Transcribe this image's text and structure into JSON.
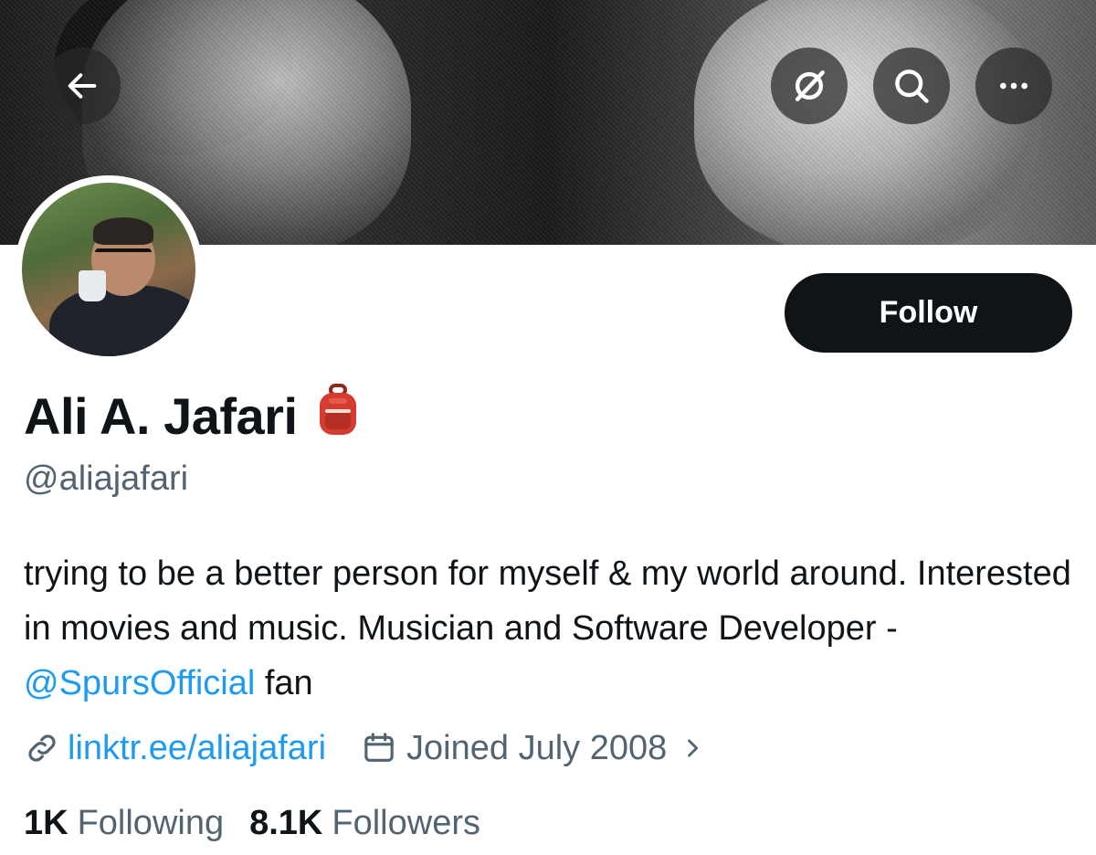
{
  "header": {
    "back_icon": "arrow-left-icon",
    "grok_icon": "grok-icon",
    "search_icon": "search-icon",
    "more_icon": "more-horizontal-icon"
  },
  "profile": {
    "display_name": "Ali A. Jafari",
    "name_emoji": "backpack-icon",
    "handle": "@aliajafari",
    "bio_text_1": "trying to be a better person for myself & my world around. Interested in movies and music. Musician and Software Developer - ",
    "bio_mention": "@SpursOfficial",
    "bio_text_2": " fan",
    "website": "linktr.ee/aliajafari",
    "joined": "Joined July 2008"
  },
  "actions": {
    "follow_label": "Follow"
  },
  "stats": {
    "following_count": "1K",
    "following_label": "Following",
    "followers_count": "8.1K",
    "followers_label": "Followers"
  },
  "colors": {
    "link": "#1d9bf0",
    "text": "#0f1419",
    "muted": "#536471",
    "button": "#0f1419"
  }
}
